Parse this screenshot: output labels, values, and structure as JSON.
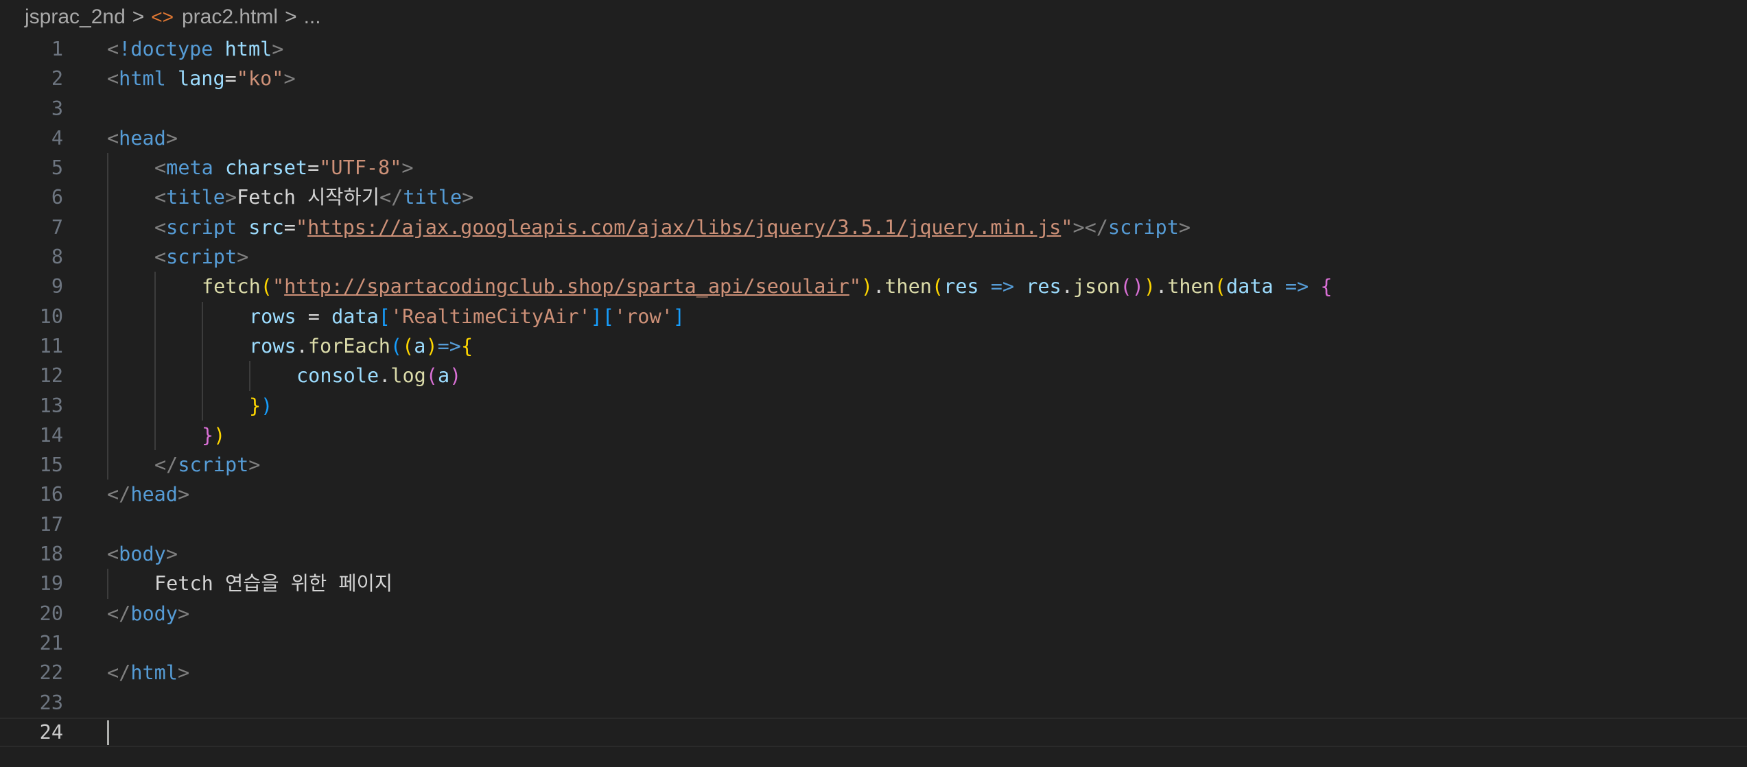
{
  "breadcrumb": {
    "folder": "jsprac_2nd",
    "file": "prac2.html",
    "more": "...",
    "separator": ">",
    "file_icon": "<>"
  },
  "colors": {
    "background": "#1f1f1f",
    "tag": "#569cd6",
    "bracket": "#808080",
    "attribute": "#9cdcfe",
    "string": "#ce9178",
    "text": "#d4d4d4",
    "function": "#dcdcaa",
    "variable": "#9cdcfe",
    "bracket_yellow": "#ffd700",
    "bracket_pink": "#da70d6",
    "bracket_blue": "#179fff",
    "operator": "#569cd6"
  },
  "editor": {
    "current_line": 24,
    "lines": [
      {
        "n": "1",
        "indent": 0,
        "tokens": [
          [
            "<",
            "bracket"
          ],
          [
            "!doctype",
            "tag"
          ],
          [
            " ",
            "text"
          ],
          [
            "html",
            "attribute"
          ],
          [
            ">",
            "bracket"
          ]
        ]
      },
      {
        "n": "2",
        "indent": 0,
        "tokens": [
          [
            "<",
            "bracket"
          ],
          [
            "html",
            "tag"
          ],
          [
            " ",
            "text"
          ],
          [
            "lang",
            "attribute"
          ],
          [
            "=",
            "text"
          ],
          [
            "\"ko\"",
            "string"
          ],
          [
            ">",
            "bracket"
          ]
        ]
      },
      {
        "n": "3",
        "indent": 0,
        "tokens": []
      },
      {
        "n": "4",
        "indent": 0,
        "tokens": [
          [
            "<",
            "bracket"
          ],
          [
            "head",
            "tag"
          ],
          [
            ">",
            "bracket"
          ]
        ]
      },
      {
        "n": "5",
        "indent": 1,
        "tokens": [
          [
            "<",
            "bracket"
          ],
          [
            "meta",
            "tag"
          ],
          [
            " ",
            "text"
          ],
          [
            "charset",
            "attribute"
          ],
          [
            "=",
            "text"
          ],
          [
            "\"UTF-8\"",
            "string"
          ],
          [
            ">",
            "bracket"
          ]
        ]
      },
      {
        "n": "6",
        "indent": 1,
        "tokens": [
          [
            "<",
            "bracket"
          ],
          [
            "title",
            "tag"
          ],
          [
            ">",
            "bracket"
          ],
          [
            "Fetch 시작하기",
            "text"
          ],
          [
            "</",
            "bracket"
          ],
          [
            "title",
            "tag"
          ],
          [
            ">",
            "bracket"
          ]
        ]
      },
      {
        "n": "7",
        "indent": 1,
        "tokens": [
          [
            "<",
            "bracket"
          ],
          [
            "script",
            "tag"
          ],
          [
            " ",
            "text"
          ],
          [
            "src",
            "attribute"
          ],
          [
            "=",
            "text"
          ],
          [
            "\"",
            "string"
          ],
          [
            "https://ajax.googleapis.com/ajax/libs/jquery/3.5.1/jquery.min.js",
            "url"
          ],
          [
            "\"",
            "string"
          ],
          [
            "></",
            "bracket"
          ],
          [
            "script",
            "tag"
          ],
          [
            ">",
            "bracket"
          ]
        ]
      },
      {
        "n": "8",
        "indent": 1,
        "tokens": [
          [
            "<",
            "bracket"
          ],
          [
            "script",
            "tag"
          ],
          [
            ">",
            "bracket"
          ]
        ]
      },
      {
        "n": "9",
        "indent": 2,
        "tokens": [
          [
            "fetch",
            "function"
          ],
          [
            "(",
            "bracket_yellow"
          ],
          [
            "\"",
            "string"
          ],
          [
            "http://spartacodingclub.shop/sparta_api/seoulair",
            "url"
          ],
          [
            "\"",
            "string"
          ],
          [
            ")",
            "bracket_yellow"
          ],
          [
            ".",
            "text"
          ],
          [
            "then",
            "function"
          ],
          [
            "(",
            "bracket_yellow"
          ],
          [
            "res",
            "variable"
          ],
          [
            " ",
            "text"
          ],
          [
            "=>",
            "operator"
          ],
          [
            " ",
            "text"
          ],
          [
            "res",
            "variable"
          ],
          [
            ".",
            "text"
          ],
          [
            "json",
            "function"
          ],
          [
            "()",
            "bracket_pink"
          ],
          [
            ")",
            "bracket_yellow"
          ],
          [
            ".",
            "text"
          ],
          [
            "then",
            "function"
          ],
          [
            "(",
            "bracket_yellow"
          ],
          [
            "data",
            "variable"
          ],
          [
            " ",
            "text"
          ],
          [
            "=>",
            "operator"
          ],
          [
            " ",
            "text"
          ],
          [
            "{",
            "bracket_pink"
          ]
        ]
      },
      {
        "n": "10",
        "indent": 3,
        "tokens": [
          [
            "rows",
            "variable"
          ],
          [
            " = ",
            "text"
          ],
          [
            "data",
            "variable"
          ],
          [
            "[",
            "bracket_blue"
          ],
          [
            "'RealtimeCityAir'",
            "string"
          ],
          [
            "]",
            "bracket_blue"
          ],
          [
            "[",
            "bracket_blue"
          ],
          [
            "'row'",
            "string"
          ],
          [
            "]",
            "bracket_blue"
          ]
        ]
      },
      {
        "n": "11",
        "indent": 3,
        "tokens": [
          [
            "rows",
            "variable"
          ],
          [
            ".",
            "text"
          ],
          [
            "forEach",
            "function"
          ],
          [
            "(",
            "bracket_blue"
          ],
          [
            "(",
            "bracket_yellow"
          ],
          [
            "a",
            "variable"
          ],
          [
            ")",
            "bracket_yellow"
          ],
          [
            "=>",
            "operator"
          ],
          [
            "{",
            "bracket_yellow"
          ]
        ]
      },
      {
        "n": "12",
        "indent": 4,
        "tokens": [
          [
            "console",
            "variable"
          ],
          [
            ".",
            "text"
          ],
          [
            "log",
            "function"
          ],
          [
            "(",
            "bracket_pink"
          ],
          [
            "a",
            "variable"
          ],
          [
            ")",
            "bracket_pink"
          ]
        ]
      },
      {
        "n": "13",
        "indent": 3,
        "tokens": [
          [
            "}",
            "bracket_yellow"
          ],
          [
            ")",
            "bracket_blue"
          ]
        ]
      },
      {
        "n": "14",
        "indent": 2,
        "tokens": [
          [
            "}",
            "bracket_pink"
          ],
          [
            ")",
            "bracket_yellow"
          ]
        ]
      },
      {
        "n": "15",
        "indent": 1,
        "tokens": [
          [
            "</",
            "bracket"
          ],
          [
            "script",
            "tag"
          ],
          [
            ">",
            "bracket"
          ]
        ]
      },
      {
        "n": "16",
        "indent": 0,
        "tokens": [
          [
            "</",
            "bracket"
          ],
          [
            "head",
            "tag"
          ],
          [
            ">",
            "bracket"
          ]
        ]
      },
      {
        "n": "17",
        "indent": 0,
        "tokens": []
      },
      {
        "n": "18",
        "indent": 0,
        "tokens": [
          [
            "<",
            "bracket"
          ],
          [
            "body",
            "tag"
          ],
          [
            ">",
            "bracket"
          ]
        ]
      },
      {
        "n": "19",
        "indent": 1,
        "tokens": [
          [
            "Fetch 연습을 위한 페이지",
            "text"
          ]
        ]
      },
      {
        "n": "20",
        "indent": 0,
        "tokens": [
          [
            "</",
            "bracket"
          ],
          [
            "body",
            "tag"
          ],
          [
            ">",
            "bracket"
          ]
        ]
      },
      {
        "n": "21",
        "indent": 0,
        "tokens": []
      },
      {
        "n": "22",
        "indent": 0,
        "tokens": [
          [
            "</",
            "bracket"
          ],
          [
            "html",
            "tag"
          ],
          [
            ">",
            "bracket"
          ]
        ]
      },
      {
        "n": "23",
        "indent": 0,
        "tokens": []
      },
      {
        "n": "24",
        "indent": 0,
        "tokens": []
      }
    ]
  }
}
